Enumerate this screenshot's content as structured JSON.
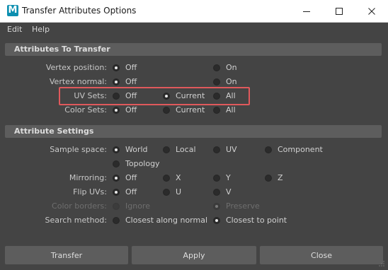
{
  "window": {
    "app_icon_letter": "M",
    "title": "Transfer Attributes Options"
  },
  "menu": {
    "items": [
      "Edit",
      "Help"
    ]
  },
  "sections": {
    "attributes_to_transfer": {
      "title": "Attributes To Transfer",
      "rows": {
        "vertex_position": {
          "label": "Vertex position:",
          "options": [
            "Off",
            "On"
          ],
          "selected": "Off"
        },
        "vertex_normal": {
          "label": "Vertex normal:",
          "options": [
            "Off",
            "On"
          ],
          "selected": "Off"
        },
        "uv_sets": {
          "label": "UV Sets:",
          "options": [
            "Off",
            "Current",
            "All"
          ],
          "selected": "Current"
        },
        "color_sets": {
          "label": "Color Sets:",
          "options": [
            "Off",
            "Current",
            "All"
          ],
          "selected": "Off"
        }
      }
    },
    "attribute_settings": {
      "title": "Attribute Settings",
      "rows": {
        "sample_space": {
          "label": "Sample space:",
          "options": [
            "World",
            "Local",
            "UV",
            "Component",
            "Topology"
          ],
          "selected": "World"
        },
        "mirroring": {
          "label": "Mirroring:",
          "options": [
            "Off",
            "X",
            "Y",
            "Z"
          ],
          "selected": "Off"
        },
        "flip_uvs": {
          "label": "Flip UVs:",
          "options": [
            "Off",
            "U",
            "V"
          ],
          "selected": "Off"
        },
        "color_borders": {
          "label": "Color borders:",
          "options": [
            "Ignore",
            "Preserve"
          ],
          "selected": "Preserve",
          "disabled": true
        },
        "search_method": {
          "label": "Search method:",
          "options": [
            "Closest along normal",
            "Closest to point"
          ],
          "selected": "Closest to point"
        }
      }
    }
  },
  "buttons": {
    "transfer": "Transfer",
    "apply": "Apply",
    "close": "Close"
  },
  "colors": {
    "highlight_box": "#e0595c",
    "app_icon": "#0c8fb0",
    "background": "#444444",
    "section_header": "#5d5d5d"
  }
}
